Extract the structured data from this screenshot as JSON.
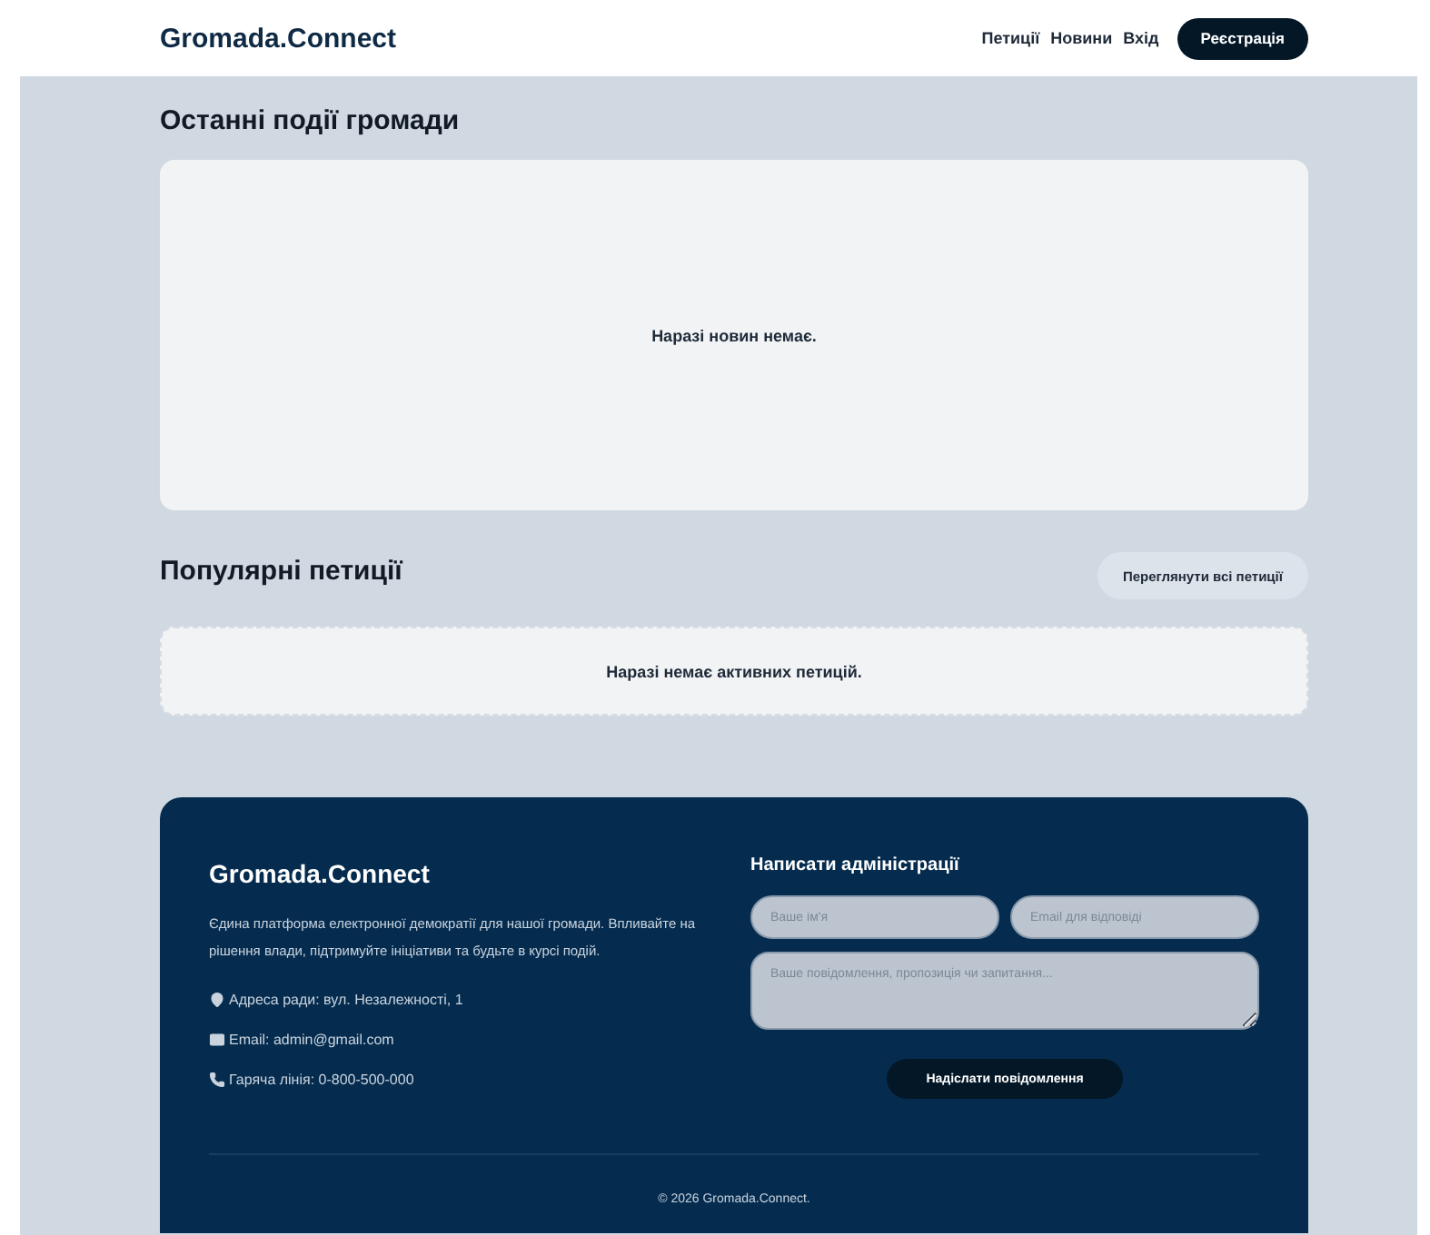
{
  "header": {
    "logo": "Gromada.Connect",
    "nav": [
      "Петиції",
      "Новини",
      "Вхід"
    ],
    "cta": "Реєстрація"
  },
  "news": {
    "title": "Останні події громади",
    "empty": "Наразі новин немає."
  },
  "petitions": {
    "title": "Популярні петиції",
    "button": "Переглянути всі петиції",
    "empty": "Наразі немає активних петицій."
  },
  "footer": {
    "brand": "Gromada.Connect",
    "description": "Єдина платформа електронної демократії для нашої громади. Впливайте на рішення влади, підтримуйте ініціативи та будьте в курсі подій.",
    "contacts": [
      {
        "kind": "address",
        "text": "Адреса ради: вул. Незалежності, 1"
      },
      {
        "kind": "email",
        "text": "Email: admin@gmail.com"
      },
      {
        "kind": "phone",
        "text": "Гаряча лінія: 0-800-500-000"
      }
    ],
    "form": {
      "title": "Написати адміністрації",
      "name_placeholder": "Ваше ім'я",
      "email_placeholder": "Email для відповіді",
      "message_placeholder": "Ваше повідомлення, пропозиція чи запитання...",
      "submit": "Надіслати повідомлення"
    },
    "copyright": "© 2026 Gromada.Connect."
  }
}
